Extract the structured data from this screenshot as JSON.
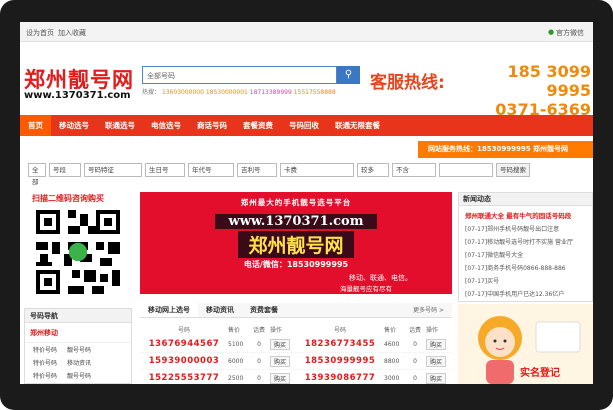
{
  "topbar": {
    "home": "设为首页",
    "favorite": "加入收藏",
    "wechat": "官方微信"
  },
  "logo": {
    "name": "郑州靓号网",
    "url": "www.1370371.com"
  },
  "search": {
    "category": "全部号码",
    "search_icon": "search-icon"
  },
  "hot": {
    "label": "热搜：",
    "numbers": [
      "13603000000",
      "18530000001",
      "18713389999",
      "15517558888"
    ]
  },
  "hotline": {
    "label": "客服热线:",
    "phone1": "185 3099 9995",
    "phone2": "0371-6369 9995"
  },
  "nav": [
    "首页",
    "移动选号",
    "联通选号",
    "电信选号",
    "商话号码",
    "套餐资费",
    "号码回收",
    "联通无限套餐"
  ],
  "notice": "网站服务热线：18530999995 郑州靓号网",
  "filters": [
    "全部",
    "号段",
    "号码特征",
    "生日号",
    "年代号",
    "吉利号",
    "卡费",
    "较多",
    "不含",
    "号码搜索"
  ],
  "qr": {
    "title": "扫描二维码咨询购买"
  },
  "banner": {
    "line1": "郑州最大的手机靓号选号平台",
    "url": "www.1370371.com",
    "name": "郑州靓号网",
    "contact": "电话/微信：18530999995",
    "carriers": "移动、联通、电信。",
    "slogan": "海量靓号应有尽有"
  },
  "news": {
    "head": "新闻动态",
    "first": "郑州联通大全 最有牛气的固话号码段",
    "items": [
      "[07-17]郑州手机号码靓号出口注意",
      "[07-17]移动靓号选号时打不实施 营业厅",
      "[07-17]微信靓号大全",
      "[07-17]商务手机号码0866-888-886",
      "[07-17]买号",
      "[07-17]中国手机用户已达12.36亿户"
    ]
  },
  "leftnav": {
    "head": "号码导航",
    "sub": "郑州移动",
    "rows": [
      [
        "特价号码",
        "靓号号码"
      ],
      [
        "特价号码",
        "移动资讯"
      ],
      [
        "特价号码",
        "靓号号码"
      ]
    ]
  },
  "tabs": {
    "items": [
      "移动网上选号",
      "移动资讯",
      "资费套餐"
    ],
    "more": "更多号码 >"
  },
  "table": {
    "headers": [
      "号码",
      "售价",
      "话费",
      "操作"
    ],
    "left": [
      {
        "number": "13676944567",
        "price": "5100",
        "fee": "0",
        "action": "购买"
      },
      {
        "number": "15939000003",
        "price": "6000",
        "fee": "0",
        "action": "购买"
      },
      {
        "number": "15225553777",
        "price": "2500",
        "fee": "0",
        "action": "购买"
      }
    ],
    "right": [
      {
        "number": "18236773455",
        "price": "4600",
        "fee": "0",
        "action": "购买"
      },
      {
        "number": "18530999995",
        "price": "8800",
        "fee": "0",
        "action": "购买"
      },
      {
        "number": "13939086777",
        "price": "3000",
        "fee": "0",
        "action": "购买"
      }
    ]
  },
  "promo": {
    "text": "实名登记"
  }
}
